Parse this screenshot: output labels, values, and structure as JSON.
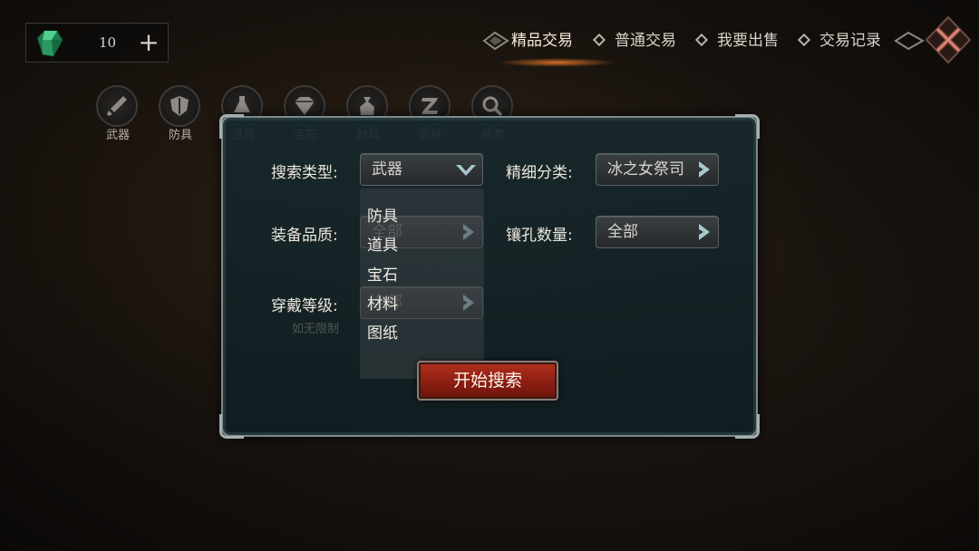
{
  "currency": {
    "icon": "emerald-gem-icon",
    "amount": "10",
    "add_label": "+"
  },
  "top_tabs": [
    {
      "label": "精品交易",
      "active": true
    },
    {
      "label": "普通交易",
      "active": false
    },
    {
      "label": "我要出售",
      "active": false
    },
    {
      "label": "交易记录",
      "active": false
    }
  ],
  "categories": [
    {
      "label": "武器",
      "icon": "sword-icon"
    },
    {
      "label": "防具",
      "icon": "shield-icon"
    },
    {
      "label": "道具",
      "icon": "potion-icon"
    },
    {
      "label": "宝石",
      "icon": "gem-icon"
    },
    {
      "label": "材料",
      "icon": "bag-icon"
    },
    {
      "label": "图纸",
      "icon": "blueprint-icon"
    },
    {
      "label": "搜索",
      "icon": "search-icon"
    }
  ],
  "search_form": {
    "search_type": {
      "label": "搜索类型:",
      "value": "武器"
    },
    "sub_category": {
      "label": "精细分类:",
      "value": "冰之女祭司"
    },
    "quality": {
      "label": "装备品质:",
      "value": "全部"
    },
    "socket_count": {
      "label": "镶孔数量:",
      "value": "全部"
    },
    "wear_level": {
      "label": "穿戴等级:",
      "value": "全部"
    },
    "dropdown_options": [
      "防具",
      "道具",
      "宝石",
      "材料",
      "图纸"
    ],
    "ghost_text": "如无限制",
    "submit_label": "开始搜索"
  },
  "colors": {
    "accent": "#b2301d",
    "panel": "#16282c",
    "glow": "#e67828"
  }
}
